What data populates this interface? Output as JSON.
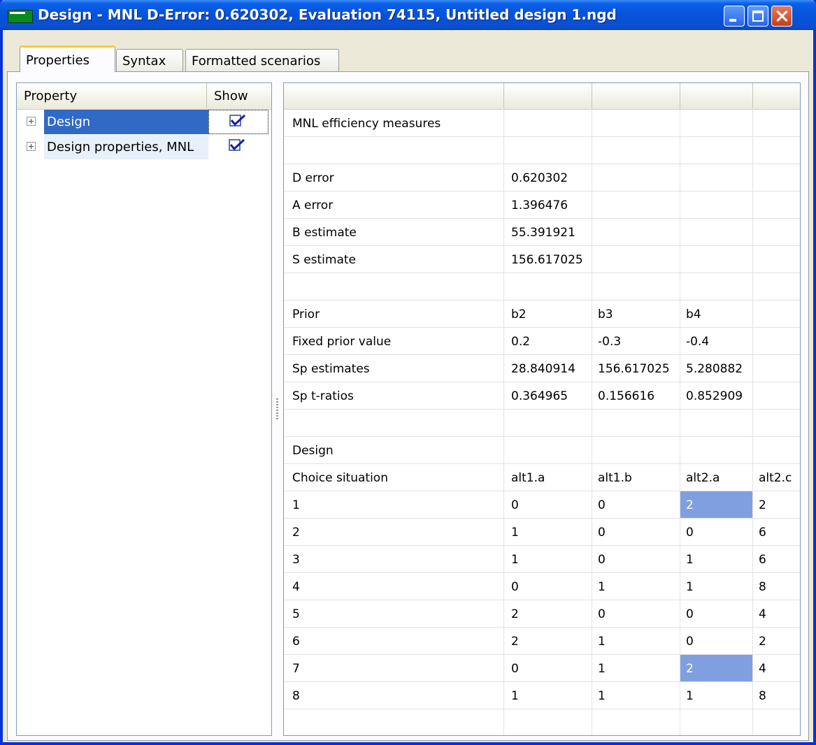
{
  "window": {
    "title": "Design  -  MNL D-Error: 0.620302,  Evaluation 74115,  Untitled design 1.ngd"
  },
  "tabs": [
    {
      "label": "Properties",
      "active": true
    },
    {
      "label": "Syntax",
      "active": false
    },
    {
      "label": "Formatted scenarios",
      "active": false
    }
  ],
  "property_panel": {
    "col_property": "Property",
    "col_show": "Show",
    "items": [
      {
        "label": "Design",
        "selected": true,
        "show_checked": true
      },
      {
        "label": "Design properties, MNL",
        "selected": false,
        "show_checked": true
      }
    ]
  },
  "grid": {
    "rows": [
      [
        "MNL efficiency measures",
        "",
        "",
        "",
        ""
      ],
      [
        "",
        "",
        "",
        "",
        ""
      ],
      [
        "D error",
        "0.620302",
        "",
        "",
        ""
      ],
      [
        "A error",
        "1.396476",
        "",
        "",
        ""
      ],
      [
        "B estimate",
        "55.391921",
        "",
        "",
        ""
      ],
      [
        "S estimate",
        "156.617025",
        "",
        "",
        ""
      ],
      [
        "",
        "",
        "",
        "",
        ""
      ],
      [
        "Prior",
        "b2",
        "b3",
        "b4",
        ""
      ],
      [
        "Fixed prior value",
        "0.2",
        "-0.3",
        "-0.4",
        ""
      ],
      [
        "Sp estimates",
        "28.840914",
        "156.617025",
        "5.280882",
        ""
      ],
      [
        "Sp t-ratios",
        "0.364965",
        "0.156616",
        "0.852909",
        ""
      ],
      [
        "",
        "",
        "",
        "",
        ""
      ],
      [
        "Design",
        "",
        "",
        "",
        ""
      ],
      [
        "Choice situation",
        "alt1.a",
        "alt1.b",
        "alt2.a",
        "alt2.c"
      ],
      [
        "1",
        "0",
        "0",
        "2",
        "2"
      ],
      [
        "2",
        "1",
        "0",
        "0",
        "6"
      ],
      [
        "3",
        "1",
        "0",
        "1",
        "6"
      ],
      [
        "4",
        "0",
        "1",
        "1",
        "8"
      ],
      [
        "5",
        "2",
        "0",
        "0",
        "4"
      ],
      [
        "6",
        "2",
        "1",
        "0",
        "2"
      ],
      [
        "7",
        "0",
        "1",
        "2",
        "4"
      ],
      [
        "8",
        "1",
        "1",
        "1",
        "8"
      ],
      [
        "",
        "",
        "",
        "",
        ""
      ]
    ],
    "highlight_color": "#7f9fe0"
  }
}
